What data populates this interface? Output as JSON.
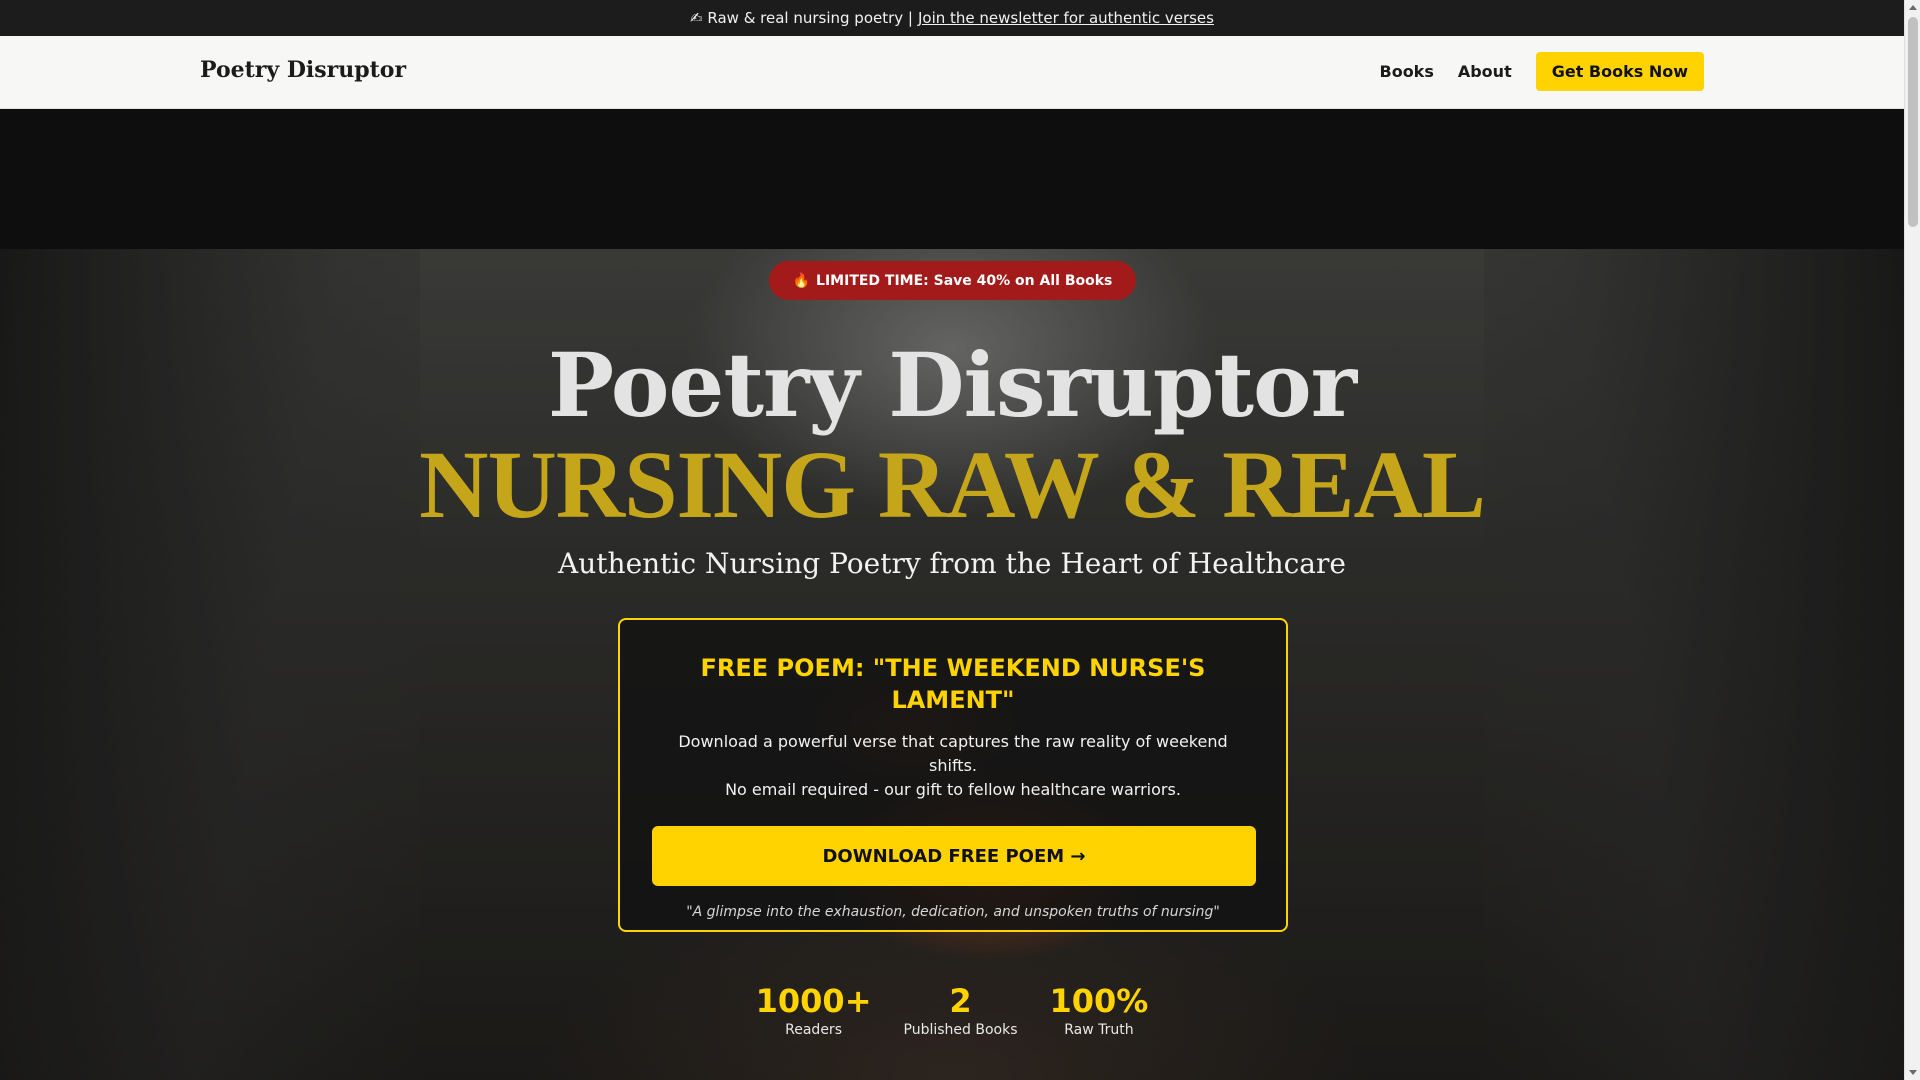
{
  "announcement": {
    "lead": "✍ Raw & real nursing poetry |",
    "link": "Join the newsletter for authentic verses"
  },
  "header": {
    "brand": "Poetry Disruptor",
    "nav": [
      "Books",
      "About"
    ],
    "cta": "Get Books Now"
  },
  "hero": {
    "badge_icon": "🔥",
    "badge_text": "LIMITED TIME: Save 40% on All Books",
    "title_line1": "Poetry Disruptor",
    "title_line2": "NURSING RAW & REAL",
    "subtitle": "Authentic Nursing Poetry from the Heart of Healthcare"
  },
  "card": {
    "title": "FREE POEM: \"THE WEEKEND NURSE'S LAMENT\"",
    "desc_line1": "Download a powerful verse that captures the raw reality of weekend shifts.",
    "desc_line2": "No email required - our gift to fellow healthcare warriors.",
    "button": "DOWNLOAD FREE POEM →",
    "quote": "\"A glimpse into the exhaustion, dedication, and unspoken truths of nursing\""
  },
  "stats": [
    {
      "value": "1000+",
      "label": "Readers"
    },
    {
      "value": "2",
      "label": "Published Books"
    },
    {
      "value": "100%",
      "label": "Raw Truth"
    }
  ],
  "colors": {
    "accent": "#ffd300",
    "title_gold": "#c5a51a",
    "badge_red": "#a31a1a"
  }
}
